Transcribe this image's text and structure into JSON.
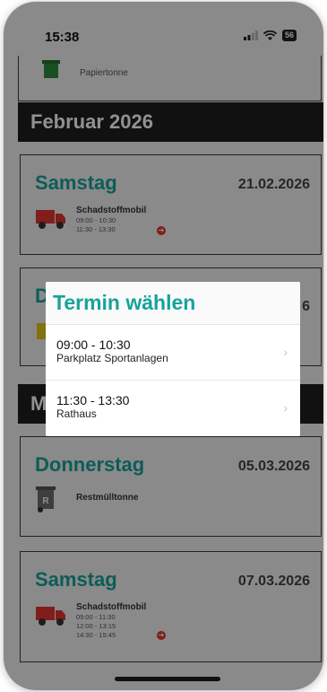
{
  "status": {
    "time": "15:38",
    "battery": "56"
  },
  "nav": {
    "back_icon": "chevron-left-icon"
  },
  "prev_fragment": {
    "label": "Papiertonne"
  },
  "months": [
    {
      "label": "Februar 2026"
    },
    {
      "label": "M"
    }
  ],
  "cards": [
    {
      "day": "Samstag",
      "date": "21.02.2026",
      "title": "Schadstoffmobil",
      "times": [
        "09:00 - 10:30",
        "11:30 - 13:30"
      ]
    },
    {
      "day": "D",
      "date": "6"
    },
    {
      "day": "Donnerstag",
      "date": "05.03.2026",
      "title": "Restmülltonne",
      "icon_letter": "R"
    },
    {
      "day": "Samstag",
      "date": "07.03.2026",
      "title": "Schadstoffmobil",
      "times": [
        "09:00 - 11:30",
        "12:00 - 13:15",
        "14:30 - 15:45"
      ]
    }
  ],
  "dialog": {
    "title": "Termin wählen",
    "options": [
      {
        "time": "09:00 - 10:30",
        "place": "Parkplatz Sportanlagen"
      },
      {
        "time": "11:30 - 13:30",
        "place": "Rathaus"
      }
    ]
  },
  "colors": {
    "accent": "#17a39a",
    "truck": "#e3342f",
    "header": "#1e1e1e"
  }
}
